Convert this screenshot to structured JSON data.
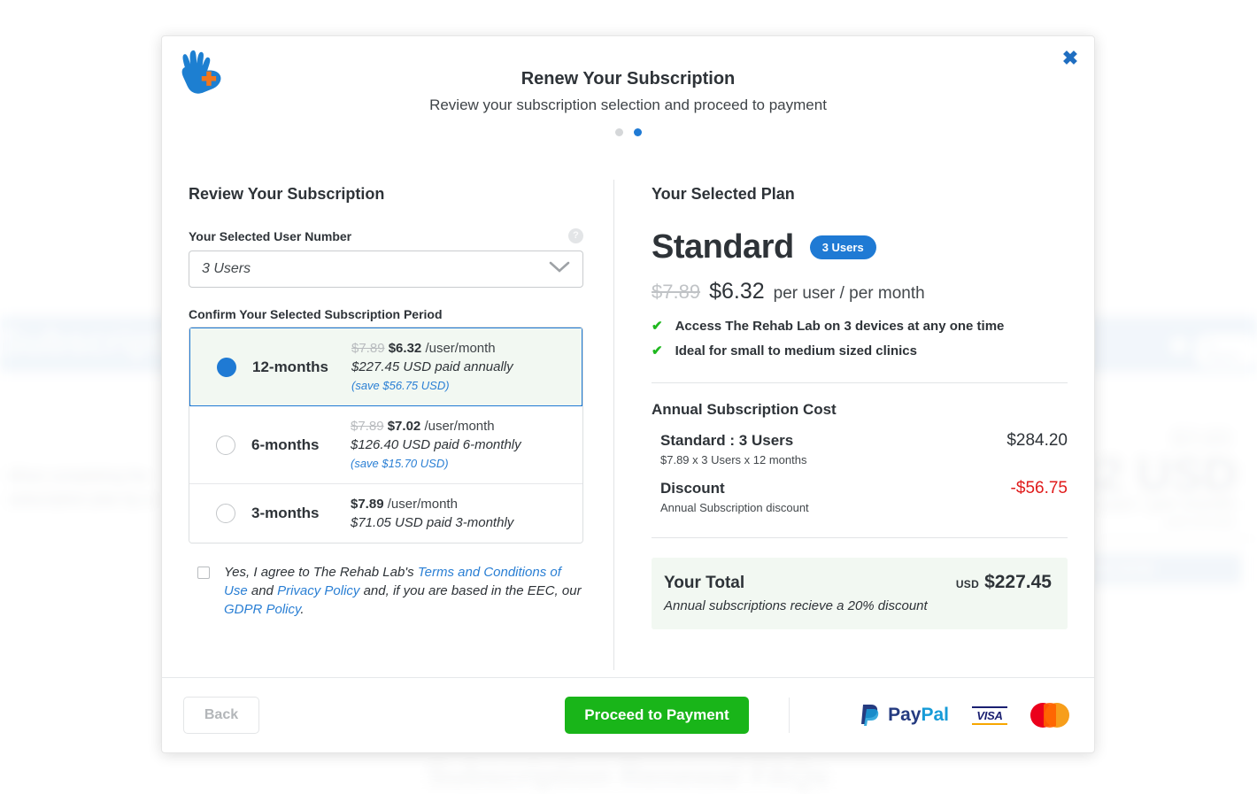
{
  "background": {
    "hero_title": "Subscription",
    "hero_help_icon": "question-mark-icon",
    "hero_pill": "3 Users",
    "left_copy": "When completing the subscription plan by a",
    "price_strike": "$7.89",
    "price_big": "6.32 USD",
    "price_sub": "per user / per month",
    "price_sub2": "paid annually",
    "renew_button": "RENEW NOW",
    "faq_heading": "Subscription Renewal FAQs"
  },
  "modal": {
    "logo_icon": "rehab-lab-hand-plus-logo",
    "close_icon": "close-icon",
    "title": "Renew Your Subscription",
    "subtitle": "Review your subscription selection and proceed to payment",
    "steps": {
      "total": 2,
      "active_index": 1
    }
  },
  "left": {
    "section_title": "Review Your Subscription",
    "user_number": {
      "label": "Your Selected User Number",
      "help_icon": "help-circle-icon",
      "value": "3 Users",
      "chevron_icon": "chevron-down-icon"
    },
    "period": {
      "label": "Confirm Your Selected Subscription Period",
      "options": [
        {
          "name": "12-months",
          "old_price": "$7.89",
          "price": "$6.32",
          "price_unit": "/user/month",
          "paid": "$227.45 USD paid annually",
          "save": "(save $56.75 USD)",
          "selected": true
        },
        {
          "name": "6-months",
          "old_price": "$7.89",
          "price": "$7.02",
          "price_unit": "/user/month",
          "paid": "$126.40 USD paid 6-monthly",
          "save": "(save $15.70 USD)",
          "selected": false
        },
        {
          "name": "3-months",
          "old_price": "",
          "price": "$7.89",
          "price_unit": "/user/month",
          "paid": "$71.05 USD paid 3-monthly",
          "save": "",
          "selected": false
        }
      ]
    },
    "terms": {
      "checked": false,
      "part1": "Yes, I agree to The Rehab Lab's ",
      "link1": "Terms and Conditions of Use",
      "part2": " and ",
      "link2": "Privacy Policy",
      "part3": " and, if you are based in the EEC, our ",
      "link3": "GDPR Policy",
      "part4": "."
    }
  },
  "right": {
    "section_title": "Your Selected Plan",
    "plan_name": "Standard",
    "plan_badge": "3 Users",
    "old_price": "$7.89",
    "price": "$6.32",
    "price_unit": "per user / per month",
    "features": [
      "Access The Rehab Lab on 3 devices at any one time",
      "Ideal for small to medium sized clinics"
    ],
    "cost_title": "Annual Subscription Cost",
    "cost_rows": [
      {
        "name": "Standard : 3 Users",
        "value": "$284.20",
        "note": "$7.89 x 3 Users x 12 months",
        "negative": false
      },
      {
        "name": "Discount",
        "value": "-$56.75",
        "note": "Annual Subscription discount",
        "negative": true
      }
    ],
    "total": {
      "label": "Your Total",
      "currency": "USD",
      "amount": "$227.45",
      "note": "Annual subscriptions recieve a 20% discount"
    }
  },
  "footer": {
    "back_label": "Back",
    "pay_label": "Proceed to Payment",
    "payment_methods": [
      "paypal-logo",
      "visa-logo",
      "mastercard-logo"
    ],
    "paypal_a": "Pay",
    "paypal_b": "Pal",
    "visa": "VISA"
  },
  "colors": {
    "accent_blue": "#1f7ad4",
    "green_button": "#19b519",
    "danger_red": "#e01b1b",
    "tick_green": "#1fb81f",
    "logo_blue": "#1d7fd1",
    "logo_orange": "#f2761b"
  }
}
